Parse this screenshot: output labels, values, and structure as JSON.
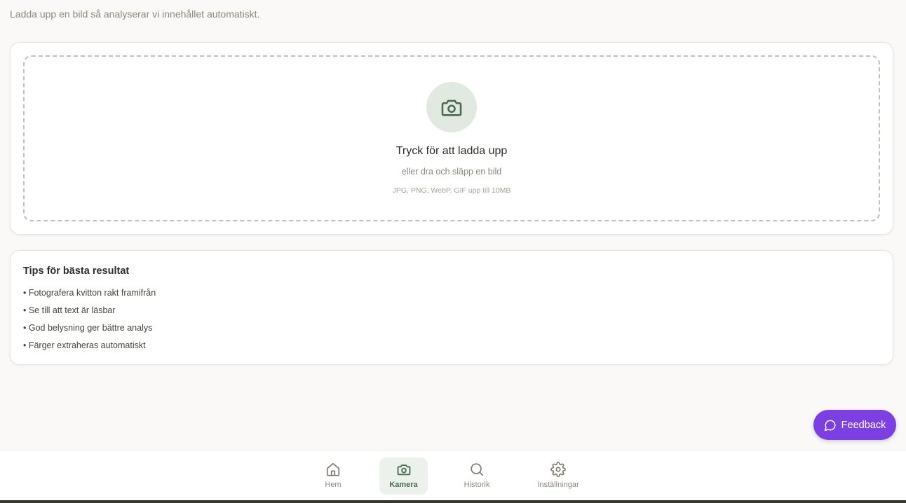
{
  "intro": {
    "text": "Ladda upp en bild så analyserar vi innehållet automatiskt."
  },
  "upload": {
    "icon": "camera-icon",
    "title": "Tryck för att ladda upp",
    "subtitle": "eller dra och släpp en bild",
    "formats": "JPG, PNG, WebP, GIF upp till 10MB"
  },
  "tips": {
    "title": "Tips för bästa resultat",
    "items": [
      "• Fotografera kvitton rakt framifrån",
      "• Se till att text är läsbar",
      "• God belysning ger bättre analys",
      "• Färger extraheras automatiskt"
    ]
  },
  "feedback": {
    "label": "Feedback",
    "icon": "chat-bubble-icon"
  },
  "nav": {
    "active": "Kamera",
    "items": [
      {
        "label": "Hem",
        "icon": "home-icon"
      },
      {
        "label": "Kamera",
        "icon": "camera-icon"
      },
      {
        "label": "Historik",
        "icon": "search-icon"
      },
      {
        "label": "Inställningar",
        "icon": "gear-icon"
      }
    ]
  },
  "colors": {
    "background": "#faf9f7",
    "accent_green": "#4a6b4f",
    "feedback_purple": "#7b3fe4"
  }
}
